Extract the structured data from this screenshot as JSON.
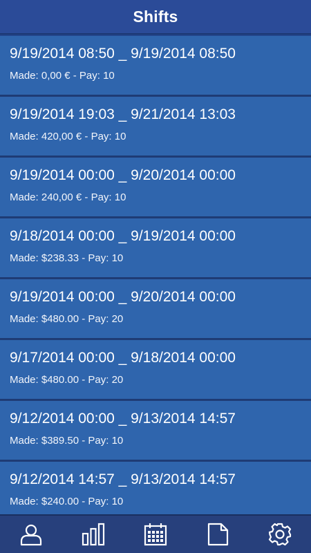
{
  "header": {
    "title": "Shifts"
  },
  "shifts": [
    {
      "range": "9/19/2014 08:50 _ 9/19/2014 08:50",
      "meta": "Made: 0,00 € - Pay: 10"
    },
    {
      "range": "9/19/2014 19:03 _ 9/21/2014 13:03",
      "meta": "Made: 420,00 € - Pay: 10"
    },
    {
      "range": "9/19/2014 00:00 _ 9/20/2014 00:00",
      "meta": "Made: 240,00 € - Pay: 10"
    },
    {
      "range": "9/18/2014 00:00 _ 9/19/2014 00:00",
      "meta": "Made: $238.33 - Pay: 10"
    },
    {
      "range": "9/19/2014 00:00 _ 9/20/2014 00:00",
      "meta": "Made: $480.00 - Pay: 20"
    },
    {
      "range": "9/17/2014 00:00 _ 9/18/2014 00:00",
      "meta": "Made: $480.00 - Pay: 20"
    },
    {
      "range": "9/12/2014 00:00 _ 9/13/2014 14:57",
      "meta": "Made: $389.50 - Pay: 10"
    },
    {
      "range": "9/12/2014 14:57 _ 9/13/2014 14:57",
      "meta": "Made: $240.00 - Pay: 10"
    }
  ],
  "tabbar": {
    "tabs": [
      {
        "icon": "person-icon"
      },
      {
        "icon": "bar-chart-icon"
      },
      {
        "icon": "calendar-icon"
      },
      {
        "icon": "document-icon"
      },
      {
        "icon": "gear-icon"
      }
    ]
  },
  "colors": {
    "header_bg": "#2b4b98",
    "item_bg": "#2f65ad",
    "tabbar_bg": "#27407c",
    "text": "#ffffff"
  }
}
